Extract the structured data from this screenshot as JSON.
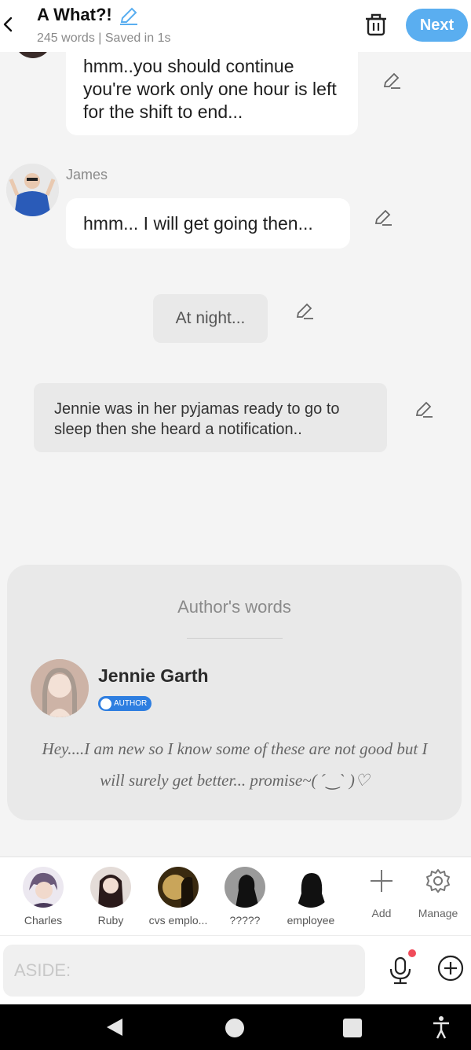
{
  "header": {
    "title": "A What?!",
    "subtitle": "245 words | Saved in 1s",
    "next_label": "Next",
    "icons": [
      "back-arrow-icon",
      "pencil-icon",
      "trash-icon"
    ]
  },
  "messages": [
    {
      "type": "dialogue",
      "speaker": "",
      "text": "hmm..you should continue you're work only one hour is left for the shift to end..."
    },
    {
      "type": "dialogue",
      "speaker": "James",
      "text": "hmm... I will get going then..."
    },
    {
      "type": "scene",
      "text": "At night..."
    },
    {
      "type": "narration",
      "text": "Jennie was in her pyjamas ready to go to sleep then she heard a notification.."
    }
  ],
  "authors_words": {
    "heading": "Author's words",
    "author_name": "Jennie Garth",
    "badge": "AUTHOR",
    "text": "Hey....I am new so I know some of these are not good but I will surely get better... promise~( ˊ‿ˋ )♡"
  },
  "characters": [
    {
      "name": "Charles",
      "color": "#6b5a7a"
    },
    {
      "name": "Ruby",
      "color": "#3a2a2a"
    },
    {
      "name": "cvs emplo...",
      "color": "#5a4420"
    },
    {
      "name": "?????",
      "color": "#9a9a9a"
    },
    {
      "name": "employee",
      "color": "#ffffff"
    }
  ],
  "tools": {
    "add_label": "Add",
    "manage_label": "Manage"
  },
  "input": {
    "placeholder": "ASIDE:"
  },
  "colors": {
    "accent": "#5aaef0",
    "badge": "#2e7ee0",
    "mic_dot": "#f04b5a"
  }
}
